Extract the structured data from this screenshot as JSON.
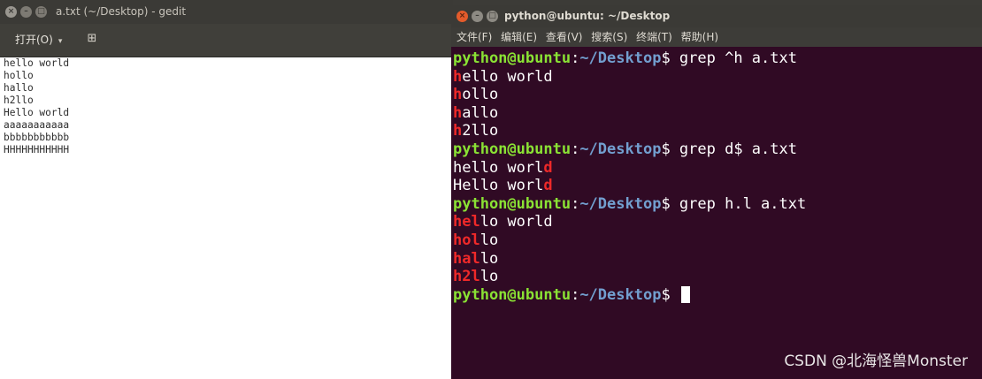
{
  "gedit": {
    "title": "a.txt (~/Desktop) - gedit",
    "open_label": "打开(O)",
    "caret": "▾",
    "pin_icon": "⊞",
    "lines": [
      "hello world",
      "hollo",
      "hallo",
      "h2llo",
      "Hello world",
      "aaaaaaaaaaa",
      "bbbbbbbbbbb",
      "HHHHHHHHHHH"
    ]
  },
  "terminal": {
    "title": "python@ubuntu: ~/Desktop",
    "menu": [
      "文件(F)",
      "编辑(E)",
      "查看(V)",
      "搜索(S)",
      "终端(T)",
      "帮助(H)"
    ],
    "prompt_user": "python@ubuntu",
    "prompt_colon": ":",
    "prompt_path": "~/Desktop",
    "prompt_dollar": "$ ",
    "commands": [
      "grep ^h a.txt",
      "grep d$ a.txt",
      "grep h.l a.txt"
    ],
    "out1": [
      {
        "hl": "h",
        "rest": "ello world"
      },
      {
        "hl": "h",
        "rest": "ollo"
      },
      {
        "hl": "h",
        "rest": "allo"
      },
      {
        "hl": "h",
        "rest": "2llo"
      }
    ],
    "out2": [
      {
        "pre": "hello worl",
        "hl": "d"
      },
      {
        "pre": "Hello worl",
        "hl": "d"
      }
    ],
    "out3": [
      {
        "hl": "hel",
        "rest": "lo world"
      },
      {
        "hl": "hol",
        "rest": "lo"
      },
      {
        "hl": "hal",
        "rest": "lo"
      },
      {
        "hl": "h2l",
        "rest": "lo"
      }
    ]
  },
  "watermark": "CSDN @北海怪兽Monster",
  "colors": {
    "terminal_bg": "#300a24",
    "prompt_user": "#8ae234",
    "prompt_path": "#729fcf",
    "match": "#ef2929"
  }
}
